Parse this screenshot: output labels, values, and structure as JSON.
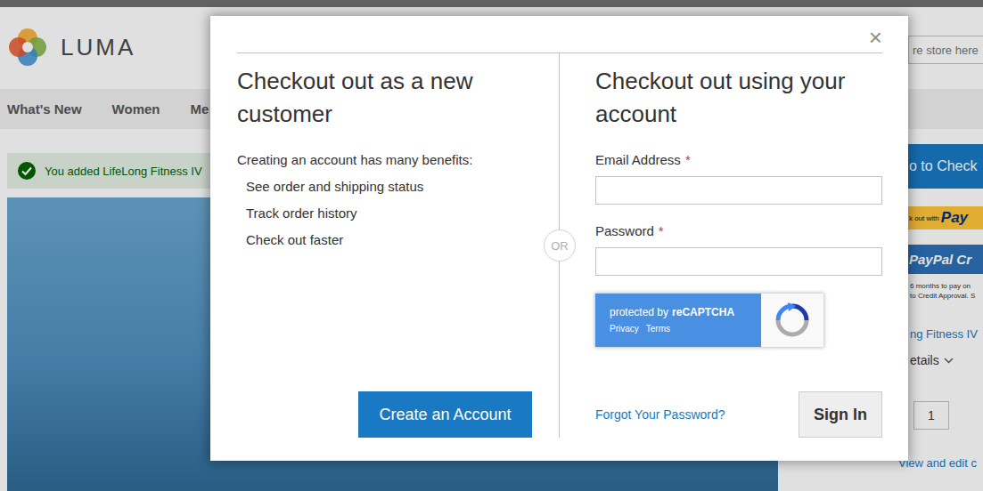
{
  "store": {
    "logo": "LUMA",
    "search_placeholder": "re store here",
    "nav": [
      "What's New",
      "Women",
      "Me"
    ],
    "message": "You added LifeLong Fitness IV"
  },
  "minicart": {
    "checkout_button": "o to Check",
    "paypal_prefix": "k out with",
    "paypal_brand": "Pay",
    "credit_button": "PayPal Cr",
    "credit_note": [
      "6 months to pay on",
      "to Credit Approval. S"
    ],
    "item_name": "ng Fitness IV",
    "details_toggle": "etails",
    "qty": "1",
    "view_edit": "View and edit c"
  },
  "modal": {
    "close": "×",
    "new_customer": {
      "title": "Checkout out as a new customer",
      "intro": "Creating an account has many benefits:",
      "benefits": [
        "See order and shipping status",
        "Track order history",
        "Check out faster"
      ],
      "button": "Create an Account"
    },
    "divider": "OR",
    "account": {
      "title": "Checkout out using your account",
      "fields": [
        {
          "label": "Email Address",
          "required_mark": "*",
          "type": "email"
        },
        {
          "label": "Password",
          "required_mark": "*",
          "type": "password"
        }
      ],
      "captcha": {
        "text": "protected by",
        "brand": "reCAPTCHA",
        "links": [
          "Privacy",
          "Terms"
        ]
      },
      "forgot": "Forgot Your Password?",
      "button": "Sign In"
    }
  }
}
